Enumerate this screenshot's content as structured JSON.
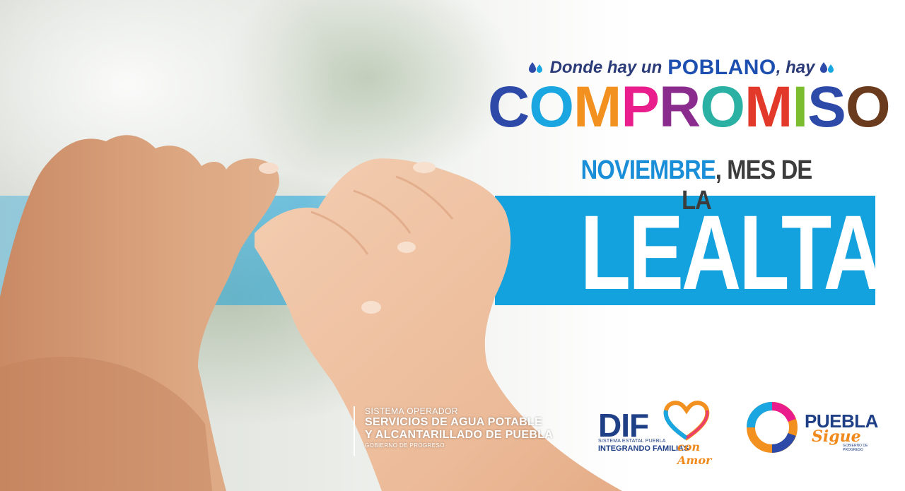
{
  "headline": {
    "tagline_before": "Donde hay un",
    "tagline_emphasis": "POBLANO",
    "tagline_after": ", hay",
    "compromiso_letters": [
      {
        "char": "C",
        "color": "#2e4aa8"
      },
      {
        "char": "O",
        "color": "#1aa6e0"
      },
      {
        "char": "M",
        "color": "#f29120"
      },
      {
        "char": "P",
        "color": "#e91e8c"
      },
      {
        "char": "R",
        "color": "#8a2b8e"
      },
      {
        "char": "O",
        "color": "#2bb0a4"
      },
      {
        "char": "M",
        "color": "#e2392b"
      },
      {
        "char": "I",
        "color": "#7bbd2e"
      },
      {
        "char": "S",
        "color": "#2e4aa8"
      },
      {
        "char": "O",
        "color": "#6b3b1e"
      }
    ]
  },
  "month": {
    "highlight": "NOVIEMBRE",
    "rest": ", MES DE LA",
    "value": "LEALTAD"
  },
  "logos": {
    "soapap": {
      "line1": "SISTEMA OPERADOR",
      "line2": "SERVICIOS DE AGUA POTABLE",
      "line3": "Y ALCANTARILLADO DE PUEBLA",
      "line4": "GOBIERNO DE PROGRESO"
    },
    "dif": {
      "word": "DIF",
      "subtitle": "SISTEMA ESTATAL PUEBLA",
      "slogan": "INTEGRANDO FAMILIAS",
      "slogan_script": "con Amor"
    },
    "puebla": {
      "word": "PUEBLA",
      "script": "Sigue",
      "small": "GOBIERNO DE PROGRESO"
    }
  },
  "colors": {
    "band": "#13a2de",
    "skin_left": "#d9a27e",
    "skin_right": "#f1c4a5"
  }
}
